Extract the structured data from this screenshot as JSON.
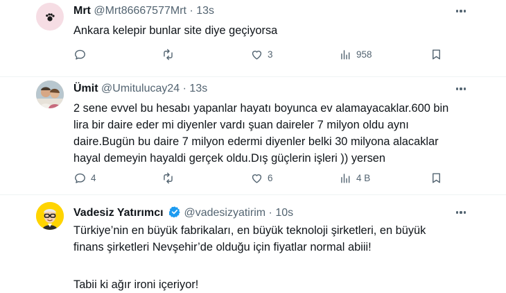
{
  "tweets": [
    {
      "name": "Mrt",
      "handle": "@Mrt86667577Mrt",
      "time": "13s",
      "text": [
        "Ankara kelepir bunlar site diye geçiyorsa"
      ],
      "replies": "",
      "retweets": "",
      "likes": "3",
      "views": "958"
    },
    {
      "name": "Ümit",
      "handle": "@Umitulucay24",
      "time": "13s",
      "text": [
        "2 sene evvel bu hesabı yapanlar hayatı boyunca ev alamayacaklar.600 bin",
        "lira bir daire eder mi diyenler vardı şuan daireler 7 milyon oldu aynı",
        "daire.Bugün bu daire 7 milyon edermi diyenler belki 30 milyona alacaklar",
        "hayal demeyin hayaldi gerçek oldu.Dış güçlerin işleri )) yersen"
      ],
      "replies": "4",
      "retweets": "",
      "likes": "6",
      "views": "4 B"
    },
    {
      "name": "Vadesiz Yatırımcı",
      "handle": "@vadesizyatirim",
      "time": "10s",
      "text": [
        "Türkiye’nin en büyük fabrikaları, en büyük teknoloji şirketleri, en büyük",
        "finans şirketleri Nevşehir’de olduğu için fiyatlar normal abiii!",
        "",
        "Tabii ki ağır ironi içeriyor!"
      ]
    }
  ],
  "dot": "·",
  "colors": {
    "text": "#0f1419",
    "secondary": "#536471",
    "verified": "#1d9bf0",
    "divider": "#eff3f4"
  }
}
